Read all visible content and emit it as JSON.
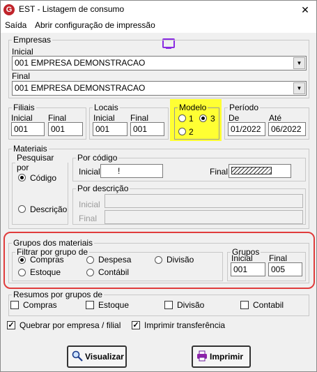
{
  "window": {
    "title": "EST - Listagem de consumo",
    "close_glyph": "✕",
    "app_icon": "G"
  },
  "menu": {
    "items": [
      "Saída",
      "Abrir configuração de impressão"
    ]
  },
  "empresas": {
    "legend": "Empresas",
    "inicial_label": "Inicial",
    "inicial_value": "001 EMPRESA DEMONSTRACAO",
    "final_label": "Final",
    "final_value": "001 EMPRESA DEMONSTRACAO"
  },
  "filiais": {
    "legend": "Filiais",
    "inicial_label": "Inicial",
    "final_label": "Final",
    "inicial_value": "001",
    "final_value": "001"
  },
  "locais": {
    "legend": "Locais",
    "inicial_label": "Inicial",
    "final_label": "Final",
    "inicial_value": "001",
    "final_value": "001"
  },
  "modelo": {
    "legend": "Modelo",
    "options": [
      "1",
      "3",
      "2"
    ],
    "selected": "3"
  },
  "periodo": {
    "legend": "Período",
    "de_label": "De",
    "ate_label": "Até",
    "de_value": "01/2022",
    "ate_value": "06/2022"
  },
  "materiais": {
    "legend": "Materiais",
    "pesquisar_legend": "Pesquisar por",
    "opt_codigo": "Código",
    "opt_descricao": "Descrição",
    "selected": "Código",
    "por_codigo_legend": "Por código",
    "codigo_inicial_label": "Inicial",
    "codigo_inicial_value": "!",
    "codigo_final_label": "Final",
    "codigo_final_value": "ZZZZZZZZ",
    "por_descricao_legend": "Por descrição",
    "desc_inicial_label": "Inicial",
    "desc_final_label": "Final"
  },
  "grupos_materiais": {
    "legend": "Grupos dos materiais",
    "filtrar_legend": "Filtrar por grupo de",
    "opt_compras": "Compras",
    "opt_despesa": "Despesa",
    "opt_divisao": "Divisão",
    "opt_estoque": "Estoque",
    "opt_contabil": "Contábil",
    "selected": "Compras",
    "grupos_legend": "Grupos",
    "inicial_label": "Inicial",
    "final_label": "Final",
    "inicial_value": "001",
    "final_value": "005"
  },
  "resumos": {
    "legend": "Resumos por grupos de",
    "items": [
      "Compras",
      "Estoque",
      "Divisão",
      "Contabil"
    ]
  },
  "options": {
    "quebrar": "Quebrar por empresa / filial",
    "quebrar_checked": true,
    "imprimir_transf": "Imprimir transferência",
    "imprimir_transf_checked": true
  },
  "buttons": {
    "visualizar": "Visualizar",
    "imprimir": "Imprimir"
  }
}
